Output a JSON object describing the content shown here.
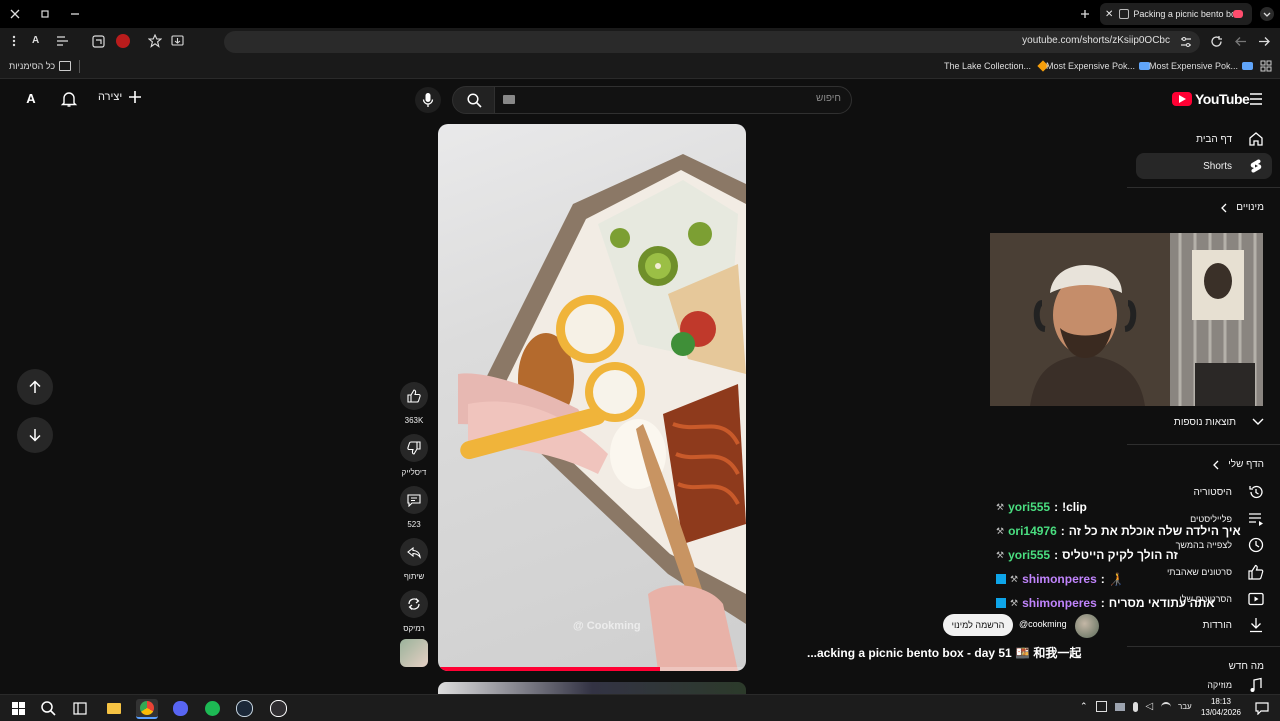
{
  "browser": {
    "tab_title": "Packing a picnic bento box",
    "url": "youtube.com/shorts/zKsiip0OCbc",
    "bookmarks": [
      {
        "label": "The Lake Collection..."
      },
      {
        "label": "Most Expensive Pok..."
      },
      {
        "label": "Most Expensive Pok..."
      }
    ],
    "bookmarks_folder": "כל הסימניות"
  },
  "header": {
    "logo": "YouTube",
    "search_placeholder": "חיפוש",
    "create_label": "יצירה"
  },
  "sidebar": {
    "top": [
      {
        "label": "דף הבית",
        "icon": "home-icon"
      },
      {
        "label": "Shorts",
        "icon": "shorts-icon",
        "active": true
      }
    ],
    "subscriptions_label": "מינויים",
    "show_more": "תוצאות נוספות",
    "you_label": "הדף שלי",
    "you_items": [
      {
        "label": "היסטוריה",
        "icon": "history-icon"
      },
      {
        "label": "פלייליסטים",
        "icon": "playlist-icon"
      },
      {
        "label": "לצפייה בהמשך",
        "icon": "watch-later-icon"
      },
      {
        "label": "סרטונים שאהבתי",
        "icon": "like-icon"
      },
      {
        "label": "הסרטונים שלי",
        "icon": "video-icon"
      },
      {
        "label": "הורדות",
        "icon": "download-icon"
      }
    ],
    "whats_new": "מה חדש",
    "music": "מוזיקה"
  },
  "short": {
    "like_count": "363K",
    "dislike_label": "דיסלייק",
    "comment_count": "523",
    "share_label": "שיתוף",
    "remix_label": "רמיקס",
    "channel": "@cookming",
    "subscribe_label": "הרשמה למינוי",
    "title": "...acking a picnic bento box - day 51 🍱 和我一起",
    "watermark": "@ Cookming",
    "progress": 0.72
  },
  "chat": [
    {
      "user": "yori555",
      "message": "!clip",
      "color": "green"
    },
    {
      "user": "ori14976",
      "message": "איך הילדה שלה אוכלת את כל זה",
      "color": "green"
    },
    {
      "user": "yori555",
      "message": "זה הולך לקיק הייטליס",
      "color": "green"
    },
    {
      "user": "shimonperes",
      "message": "🧑‍🦯",
      "color": "purple"
    },
    {
      "user": "shimonperes",
      "message": "אתה עתודאי מסריח",
      "color": "purple"
    }
  ],
  "taskbar": {
    "time": "18:13",
    "date": "13/04/2026",
    "lang": "עבר"
  },
  "colors": {
    "accent": "#ff0033",
    "chat_green": "#4ade80",
    "chat_purple": "#c084fc"
  }
}
